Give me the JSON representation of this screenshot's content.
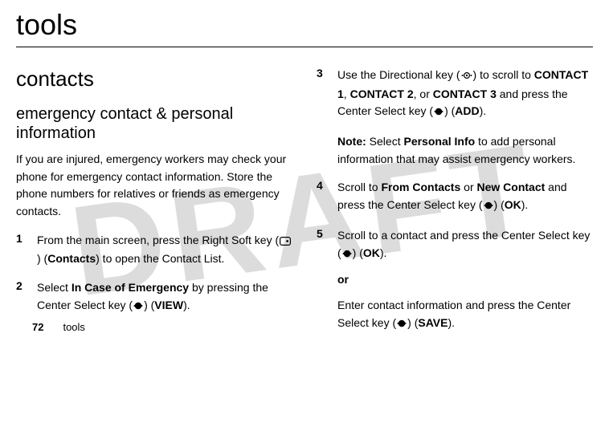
{
  "watermark": "DRAFT",
  "page_title": "tools",
  "section_heading": "contacts",
  "subsection_heading": "emergency contact & personal information",
  "intro": "If you are injured, emergency workers may check your phone for emergency contact information. Store the phone numbers for relatives or friends as emergency contacts.",
  "tokens": {
    "Contacts": "Contacts",
    "InCaseOfEmergency": "In Case of Emergency",
    "VIEW": "VIEW",
    "CONTACT1": "CONTACT 1",
    "CONTACT2": "CONTACT 2",
    "CONTACT3": "CONTACT 3",
    "ADD": "ADD",
    "PersonalInfo": "Personal Info",
    "FromContacts": "From Contacts",
    "NewContact": "New Contact",
    "OK": "OK",
    "SAVE": "SAVE",
    "Note": "Note:",
    "or": "or"
  },
  "steps": {
    "s1_pre": "From the main screen, press the Right Soft key (",
    "s1_mid": ") (",
    "s1_post": ") to open the Contact List.",
    "s2_a": "Select ",
    "s2_b": " by pressing the Center Select key (",
    "s2_c": ") (",
    "s2_d": ").",
    "s3_a": "Use the Directional key (",
    "s3_b": ") to scroll to ",
    "s3_c": ", ",
    "s3_d": ", or ",
    "s3_e": " and press the Center Select key (",
    "s3_f": ") (",
    "s3_g": ").",
    "note_a": " Select ",
    "note_b": " to add personal information that may assist emergency workers.",
    "s4_a": "Scroll to ",
    "s4_b": " or ",
    "s4_c": " and press the Center Select key (",
    "s4_d": ") (",
    "s4_e": ").",
    "s5_a": "Scroll to a contact and press the Center Select key (",
    "s5_b": ") (",
    "s5_c": ").",
    "s5_or_a": "Enter contact information and press the Center Select key (",
    "s5_or_b": ") (",
    "s5_or_c": ")."
  },
  "footer": {
    "page_number": "72",
    "label": "tools"
  }
}
